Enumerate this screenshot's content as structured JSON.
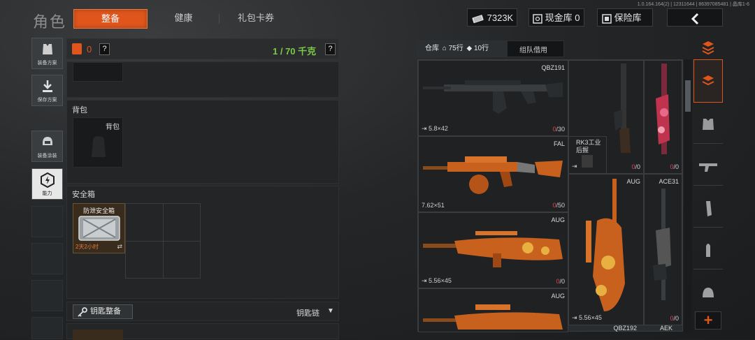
{
  "version": "1.0.164.164(2) | 12311644 | 86397085481 | 晶库1-6",
  "page_title": "角色",
  "tabs": [
    {
      "label": "整备",
      "active": true
    },
    {
      "label": "健康",
      "active": false
    },
    {
      "label": "礼包卡券",
      "active": false
    }
  ],
  "top_bar": {
    "currency": "7323K",
    "cash_storage": "现金库 0",
    "safe_storage": "保险库"
  },
  "left_nav": {
    "items": [
      {
        "label": "装备方案"
      },
      {
        "label": "保存方案"
      },
      {
        "label": "装备涂装"
      },
      {
        "label": "能力"
      }
    ]
  },
  "loadout": {
    "count": "0",
    "weight": "1 / 70 千克",
    "help": "?",
    "backpack_section": "背包",
    "backpack_slot": "背包",
    "safe_section": "安全箱",
    "safe_item_name": "防泄安全箱",
    "safe_item_timer": "2天2小时",
    "key_button": "钥匙整备",
    "key_chain": "钥匙链"
  },
  "storage": {
    "tab_warehouse": "仓库",
    "rows_home": "75行",
    "rows_tag": "10行",
    "tab_team": "组队借用",
    "items": [
      {
        "name": "QBZ191",
        "caliber": "5.8×42",
        "ammo_current": "0",
        "ammo_max": "/30"
      },
      {
        "name": "FAL",
        "caliber": "7.62×51",
        "ammo_current": "0",
        "ammo_max": "/50"
      },
      {
        "name": "RK3工业后握",
        "ammo_current": "0",
        "ammo_max": "/0"
      },
      {
        "name": "AUG",
        "caliber": "5.56×45",
        "ammo_current": "0",
        "ammo_max": "/0"
      },
      {
        "name": "AUG",
        "caliber": "",
        "ammo_current": "",
        "ammo_max": ""
      },
      {
        "name": "AUG",
        "caliber": "5.56×45",
        "ammo_current": "0",
        "ammo_max": "/0"
      },
      {
        "name": "ACE31",
        "ammo_current": "0",
        "ammo_max": "/0"
      },
      {
        "name": "QBZ192"
      },
      {
        "name": "AEK"
      }
    ],
    "vertical_counts": [
      {
        "ammo_current": "0",
        "ammo_max": "/0"
      },
      {
        "ammo_current": "0",
        "ammo_max": "/0"
      }
    ]
  },
  "colors": {
    "accent": "#e0551c",
    "green": "#7cc94a",
    "red": "#e0465a"
  }
}
